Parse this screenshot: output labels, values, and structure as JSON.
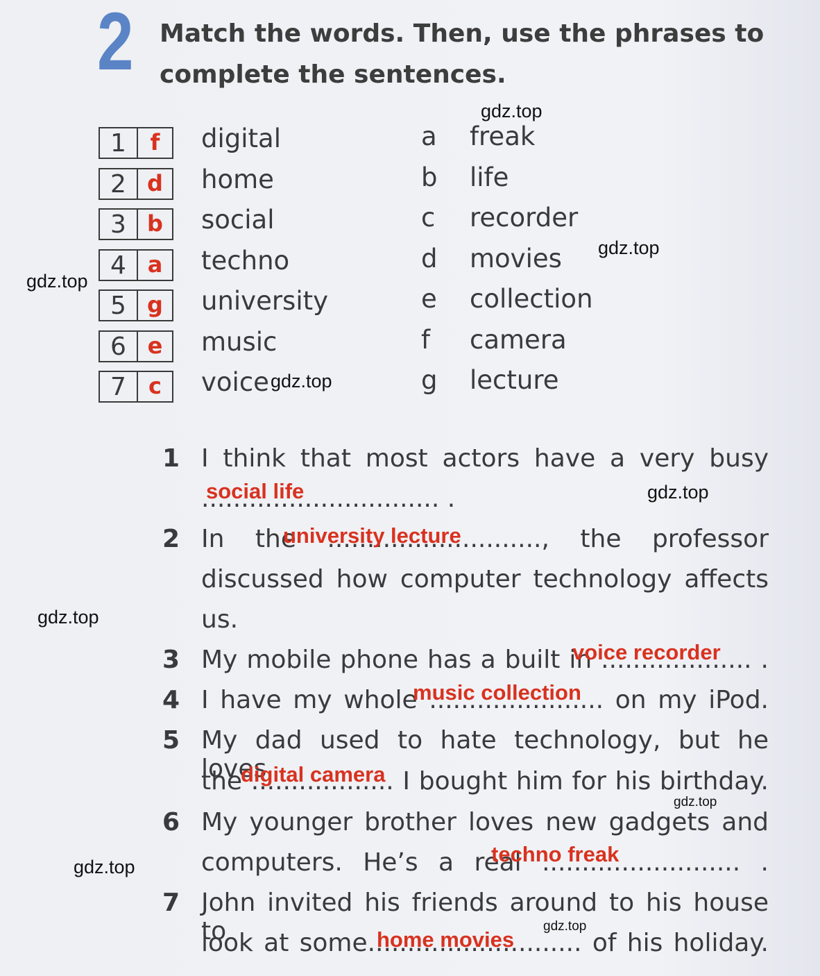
{
  "exercise": {
    "number": "2",
    "title_lines": [
      "Match the words. Then, use the phrases to",
      "complete the sentences."
    ]
  },
  "matching": {
    "rows": [
      {
        "num": "1",
        "answer": "f",
        "word": "digital"
      },
      {
        "num": "2",
        "answer": "d",
        "word": "home"
      },
      {
        "num": "3",
        "answer": "b",
        "word": "social"
      },
      {
        "num": "4",
        "answer": "a",
        "word": "techno"
      },
      {
        "num": "5",
        "answer": "g",
        "word": "university"
      },
      {
        "num": "6",
        "answer": "e",
        "word": "music"
      },
      {
        "num": "7",
        "answer": "c",
        "word": "voice"
      }
    ],
    "options": [
      {
        "letter": "a",
        "word": "freak"
      },
      {
        "letter": "b",
        "word": "life"
      },
      {
        "letter": "c",
        "word": "recorder"
      },
      {
        "letter": "d",
        "word": "movies"
      },
      {
        "letter": "e",
        "word": "collection"
      },
      {
        "letter": "f",
        "word": "camera"
      },
      {
        "letter": "g",
        "word": "lecture"
      }
    ]
  },
  "sentences": [
    {
      "num": "1",
      "lines": [
        "I think that most actors have a very busy",
        ".............................. ."
      ],
      "answer": "social life"
    },
    {
      "num": "2",
      "lines": [
        "In the ..........................., the professor",
        "discussed how computer technology affects",
        "us."
      ],
      "answer": "university lecture"
    },
    {
      "num": "3",
      "lines": [
        "My mobile phone has a built in ................... ."
      ],
      "answer": "voice recorder"
    },
    {
      "num": "4",
      "lines": [
        "I have my whole ...................... on my iPod."
      ],
      "answer": "music collection"
    },
    {
      "num": "5",
      "lines": [
        "My dad used to hate technology, but he loves",
        "the .................. I bought him for his birthday."
      ],
      "answer": "digital camera"
    },
    {
      "num": "6",
      "lines": [
        "My younger brother loves new gadgets and",
        "computers. He’s a real ......................... ."
      ],
      "answer": "techno freak"
    },
    {
      "num": "7",
      "lines": [
        "John invited his friends around to his house to",
        "look at some........................... of his holiday."
      ],
      "answer": "home movies"
    }
  ],
  "watermark": "gdz.top",
  "colors": {
    "answer": "#d8321f",
    "exercise_number": "#5b84c6"
  }
}
